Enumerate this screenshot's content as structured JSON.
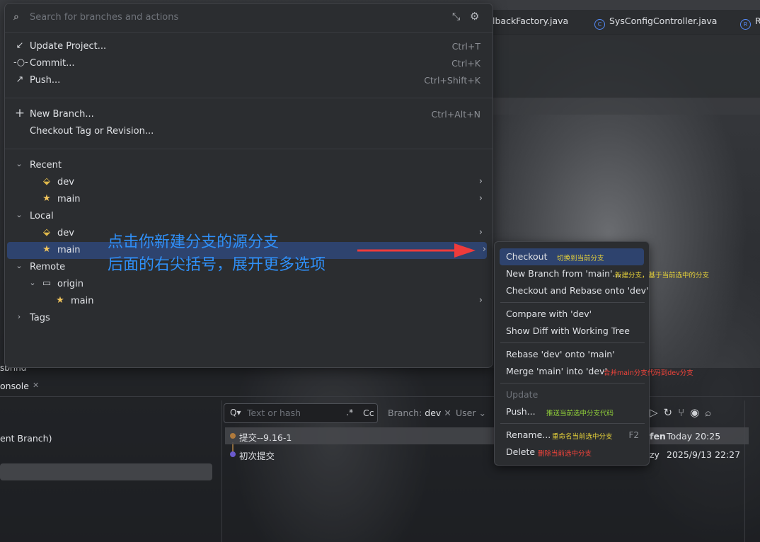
{
  "editor_tabs": [
    {
      "label": "lbackFactory.java"
    },
    {
      "label": "SysConfigController.java",
      "icon": "c-class-icon"
    },
    {
      "label": "R",
      "icon": "r-class-icon"
    }
  ],
  "bottom": {
    "console_tab": "onsole",
    "partial_label": "sbrind",
    "left_branch_label": "ent Branch)",
    "search_placeholder": "Text or hash",
    "regex_label": ".*",
    "case_label": "Cc",
    "branch_filter_prefix": "Branch:",
    "branch_filter_value": "dev",
    "user_filter": "User",
    "commits": [
      {
        "message": "提交--9.16-1",
        "author": "fen",
        "date": "Today 20:25",
        "color": "#b07a3c"
      },
      {
        "message": "初次提交",
        "author": "zy",
        "date": "2025/9/13 22:27",
        "color": "#6a5acd"
      }
    ]
  },
  "popup": {
    "search_placeholder": "Search for branches and actions",
    "actions": [
      {
        "label": "Update Project...",
        "shortcut": "Ctrl+T",
        "icon": "update-arrow-icon"
      },
      {
        "label": "Commit...",
        "shortcut": "Ctrl+K",
        "icon": "commit-icon"
      },
      {
        "label": "Push...",
        "shortcut": "Ctrl+Shift+K",
        "icon": "push-arrow-icon"
      }
    ],
    "new_branch": {
      "label": "New Branch...",
      "shortcut": "Ctrl+Alt+N"
    },
    "checkout_tag": {
      "label": "Checkout Tag or Revision..."
    },
    "tree": {
      "recent": {
        "label": "Recent",
        "items": [
          "dev",
          "main"
        ]
      },
      "local": {
        "label": "Local",
        "items": [
          "dev",
          "main"
        ]
      },
      "remote": {
        "label": "Remote",
        "origin": "origin",
        "items": [
          "main"
        ]
      },
      "tags": {
        "label": "Tags"
      }
    }
  },
  "annotation": {
    "line1": "点击你新建分支的源分支",
    "line2": "后面的右尖括号，展开更多选项",
    "color": "#2f8ff7",
    "arrow_color": "#ee3b3b"
  },
  "submenu": {
    "items": [
      {
        "label": "Checkout",
        "note": "切换到当前分支",
        "note_color": "yellow"
      },
      {
        "label": "New Branch from 'main'...",
        "note": "新建分支，基于当前选中的分支",
        "note_color": "yellow"
      },
      {
        "label": "Checkout and Rebase onto 'dev'"
      },
      {
        "label": "Compare with 'dev'"
      },
      {
        "label": "Show Diff with Working Tree"
      },
      {
        "label": "Rebase 'dev' onto 'main'"
      },
      {
        "label": "Merge 'main' into 'dev'",
        "note": "合并main分支代码到dev分支",
        "note_color": "red"
      },
      {
        "label": "Update"
      },
      {
        "label": "Push...",
        "note": "推送当前选中分支代码",
        "note_color": "green"
      },
      {
        "label": "Rename...",
        "note": "重命名当前选中分支",
        "note_color": "yellow",
        "shortcut": "F2"
      },
      {
        "label": "Delete",
        "note": "删除当前选中分支",
        "note_color": "red"
      }
    ]
  }
}
